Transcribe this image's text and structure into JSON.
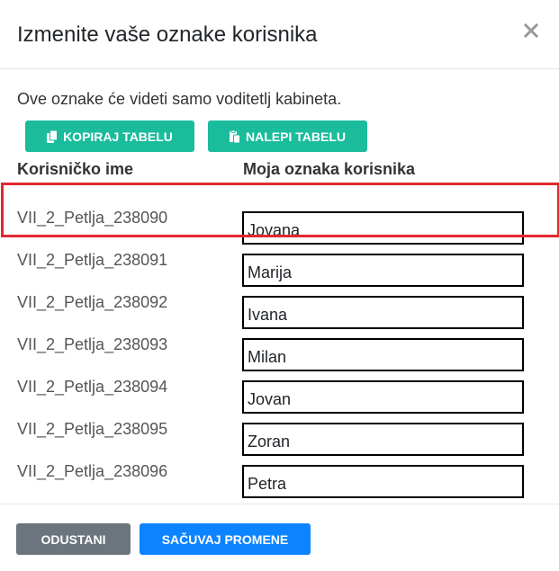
{
  "dialog": {
    "title": "Izmenite vaše oznake korisnika",
    "close_icon": "close-icon"
  },
  "body": {
    "intro": "Ove oznake će videti samo voditetlj kabineta.",
    "copy_button": "KOPIRAJ TABELU",
    "copy_icon": "copy-icon",
    "paste_button": "NALEPI TABELU",
    "paste_icon": "paste-icon",
    "columns": {
      "username": "Korisničko ime",
      "label": "Moja oznaka korisnika"
    },
    "rows": [
      {
        "username": "VII_2_Petlja_238090",
        "label": "Jovana",
        "highlighted": true
      },
      {
        "username": "VII_2_Petlja_238091",
        "label": "Marija"
      },
      {
        "username": "VII_2_Petlja_238092",
        "label": "Ivana"
      },
      {
        "username": "VII_2_Petlja_238093",
        "label": "Milan"
      },
      {
        "username": "VII_2_Petlja_238094",
        "label": "Jovan"
      },
      {
        "username": "VII_2_Petlja_238095",
        "label": "Zoran"
      },
      {
        "username": "VII_2_Petlja_238096",
        "label": "Petra"
      }
    ]
  },
  "footer": {
    "cancel_button": "ODUSTANI",
    "save_button": "SAČUVAJ PROMENE"
  },
  "colors": {
    "teal_button": "#1abc9c",
    "cancel_button": "#6c757d",
    "save_button": "#0d84ff",
    "highlight": "#e0282f"
  }
}
